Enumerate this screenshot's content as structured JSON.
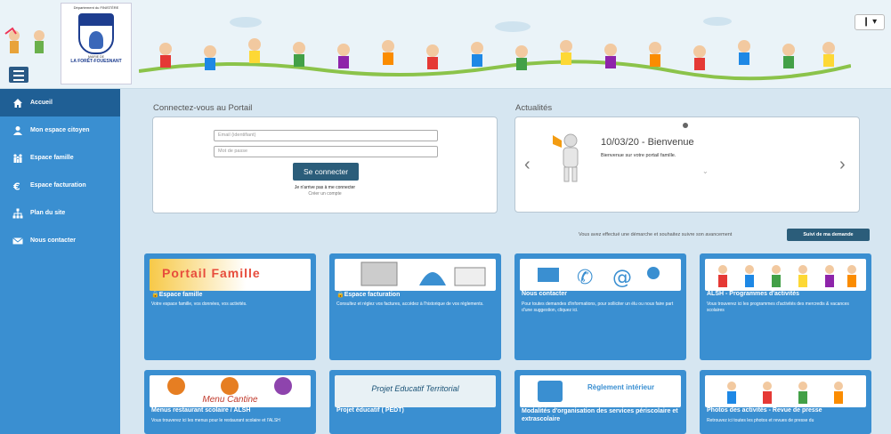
{
  "header": {
    "logo": {
      "department": "Département du FINISTÈRE",
      "mairie": "MAIRIE DE",
      "town": "LA FORÊT-FOUESNANT"
    },
    "user_menu_label": "❙ ▾",
    "menu_icon": "hamburger-icon"
  },
  "sidebar": {
    "items": [
      {
        "label": "Accueil",
        "icon": "home-icon",
        "active": true
      },
      {
        "label": "Mon espace citoyen",
        "icon": "user-icon",
        "active": false
      },
      {
        "label": "Espace famille",
        "icon": "family-icon",
        "active": false
      },
      {
        "label": "Espace facturation",
        "icon": "euro-icon",
        "active": false
      },
      {
        "label": "Plan du site",
        "icon": "sitemap-icon",
        "active": false
      },
      {
        "label": "Nous contacter",
        "icon": "envelope-icon",
        "active": false
      }
    ]
  },
  "login": {
    "title": "Connectez-vous au Portail",
    "email_placeholder": "Email (identifiant)",
    "password_placeholder": "Mot de passe",
    "submit_label": "Se connecter",
    "forgot_label": "Je n'arrive pas à me connecter",
    "create_label": "Créer un compte"
  },
  "news": {
    "title": "Actualités",
    "headline": "10/03/20 - Bienvenue",
    "text": "Bienvenue sur votre portail famille.",
    "prev": "‹",
    "next": "›"
  },
  "notice": {
    "text": "Vous avez effectué une démarche et souhaitez suivre son avancement",
    "button_label": "Suivi de ma demande"
  },
  "tiles": [
    {
      "title": "🔒Espace famille",
      "desc": "Votre espace famille, vos données, vos activités.",
      "image_text": "Portail Famille"
    },
    {
      "title": "🔒Espace facturation",
      "desc": "Consultez et réglez vos factures, accédez à l'historique de vos règlements.",
      "image_text": ""
    },
    {
      "title": "Nous contacter",
      "desc": "Pour toutes demandes d'informations, pour solliciter un élu ou nous faire part d'une suggestion, cliquez ici.",
      "image_text": ""
    },
    {
      "title": "ALSH - Programmes d'activités",
      "desc": "Vous trouverez ici les programmes d'activités des mercredis & vacances scolaires",
      "image_text": ""
    },
    {
      "title": "Menus restaurant scolaire / ALSH",
      "desc": "Vous trouverez ici les menus pour le restaurant scolaire et l'ALSH",
      "image_text": "Menu Cantine"
    },
    {
      "title": "Projet éducatif ( PEDT)",
      "desc": "",
      "image_text": "Projet Educatif Territorial"
    },
    {
      "title": "Modalités d'organisation des services périscolaire et extrascolaire",
      "desc": "",
      "image_text": "Règlement intérieur"
    },
    {
      "title": "Photos des activités - Revue de presse",
      "desc": "Retrouvez ici toutes les photos et revues de presse du",
      "image_text": ""
    }
  ],
  "colors": {
    "sidebar": "#3a8fd1",
    "sidebar_active": "#1f5f95",
    "button": "#2b5d7a",
    "tile": "#3a8fd1"
  }
}
